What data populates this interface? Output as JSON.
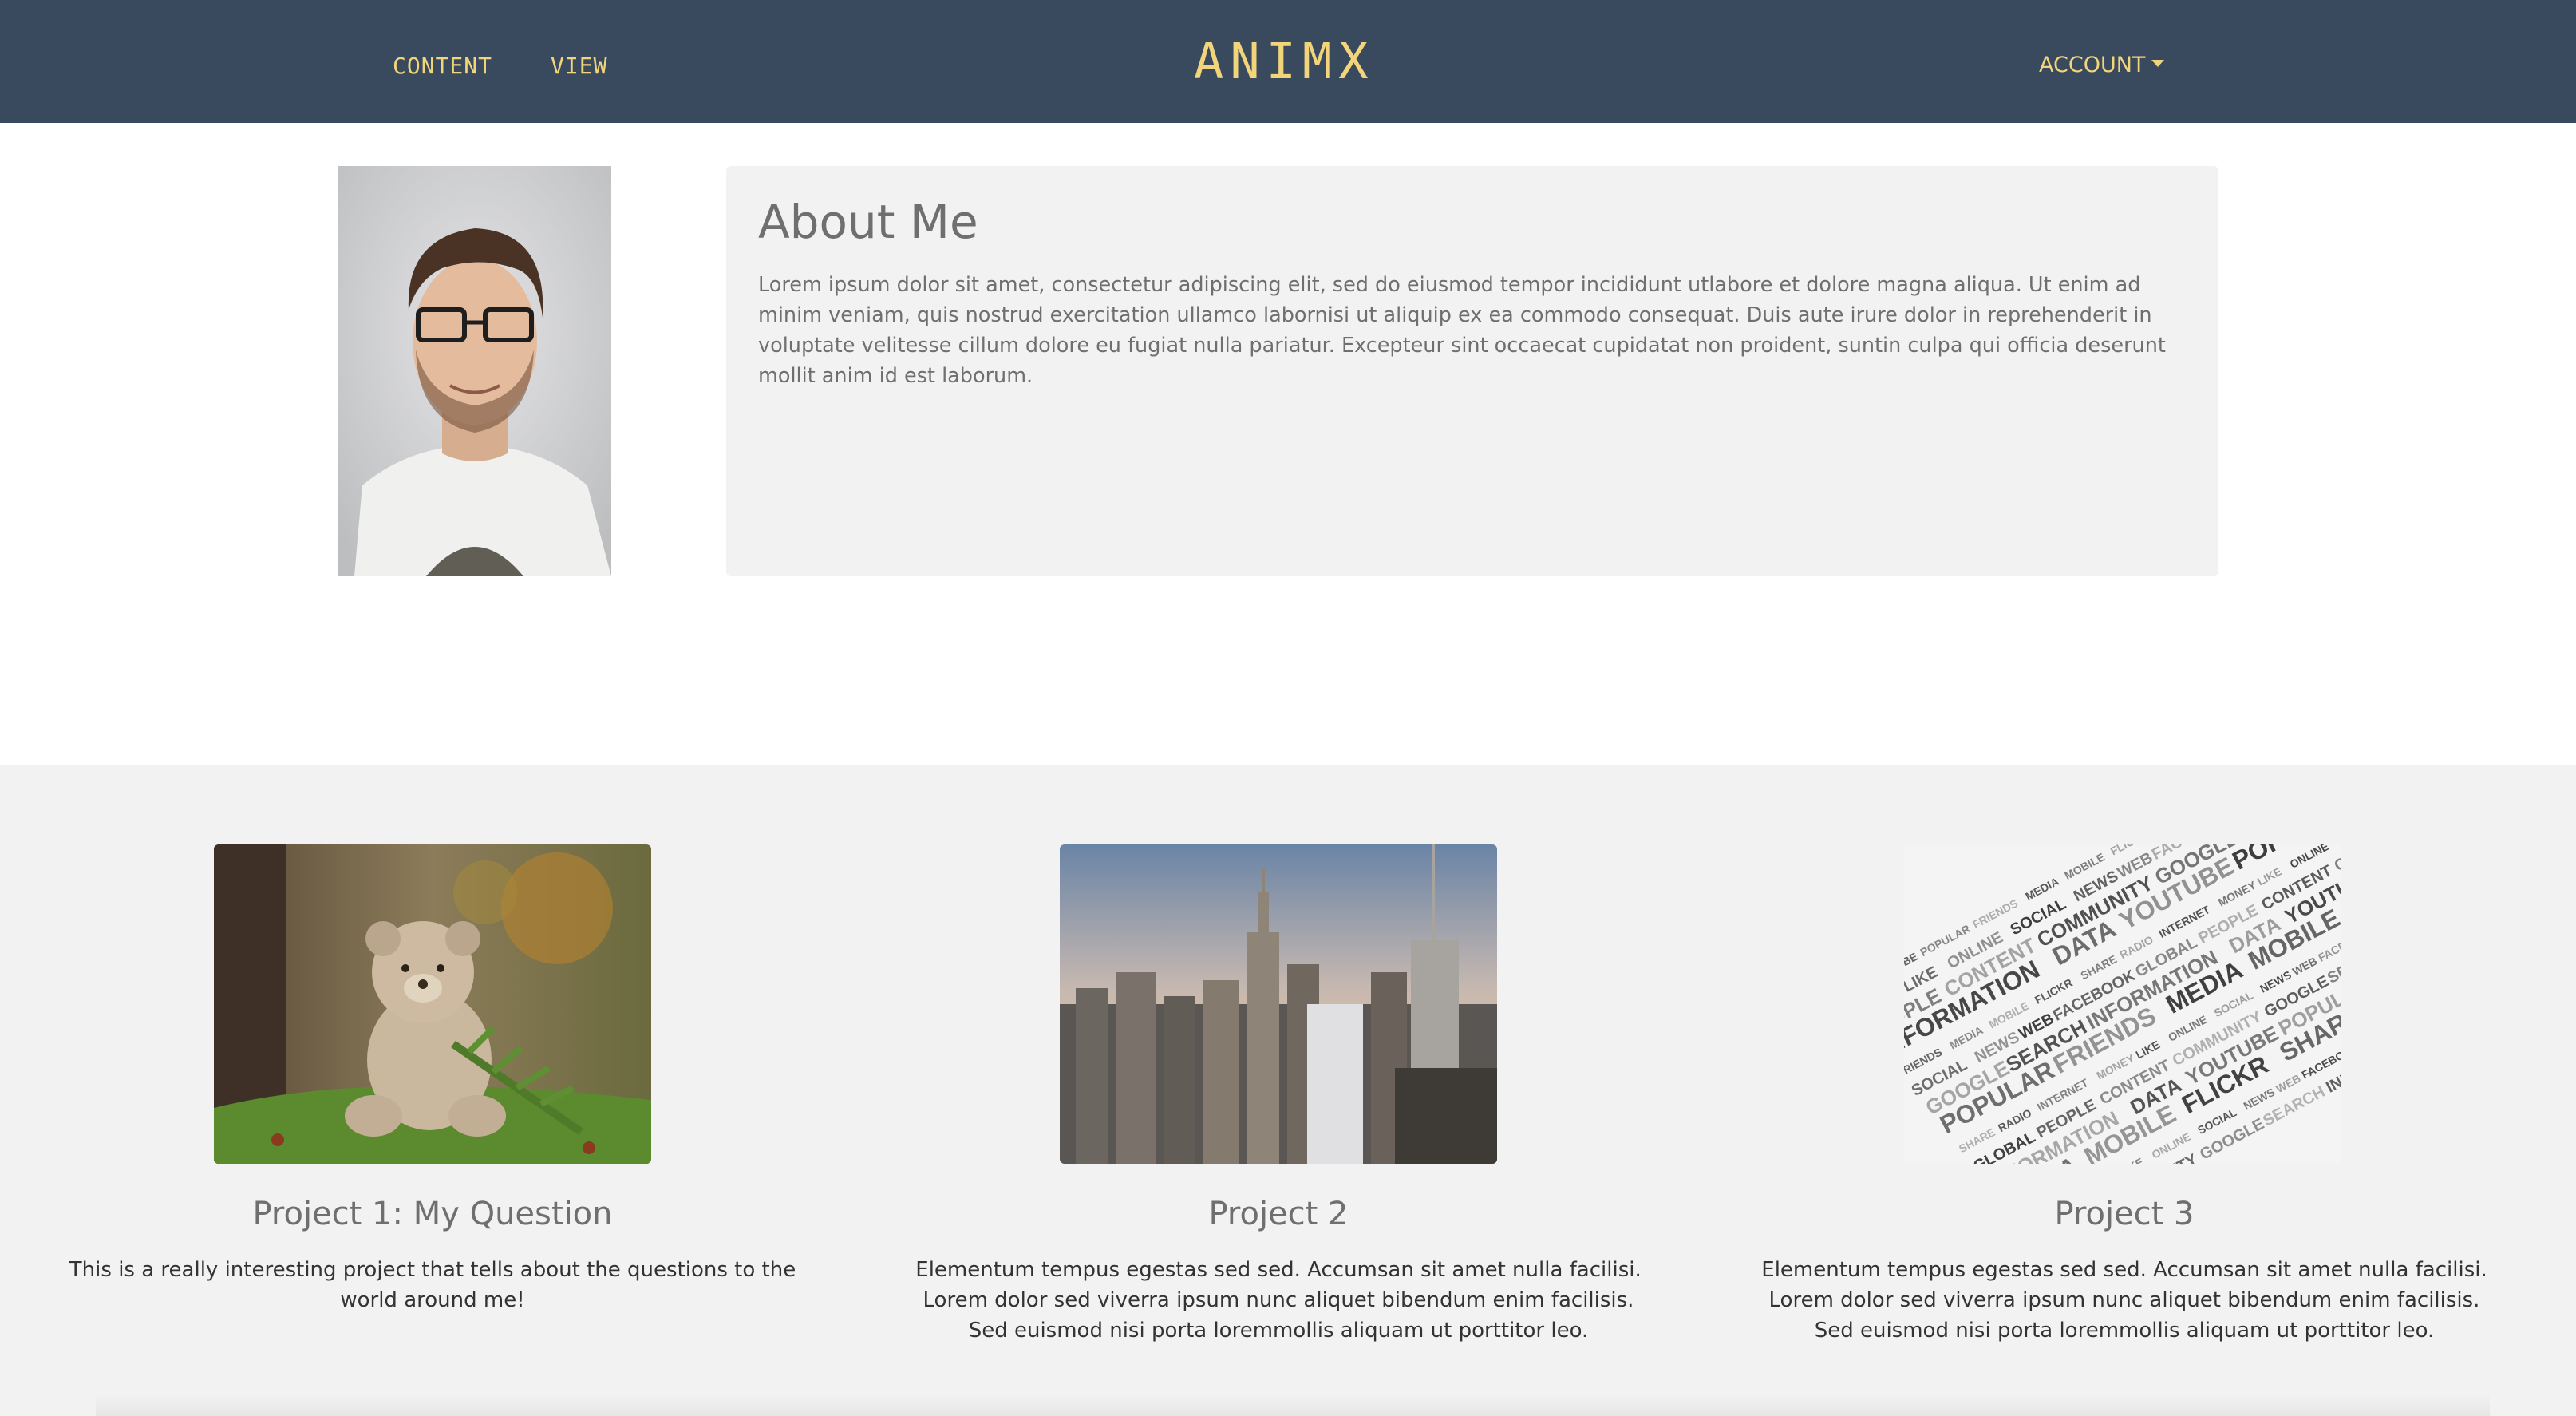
{
  "navbar": {
    "links": [
      "CONTENT",
      "VIEW"
    ],
    "brand": "ANIMX",
    "account_label": "ACCOUNT"
  },
  "about": {
    "title": "About Me",
    "text": "Lorem ipsum dolor sit amet, consectetur adipiscing elit, sed do eiusmod tempor incididunt utlabore et dolore magna aliqua. Ut enim ad minim veniam, quis nostrud exercitation ullamco labornisi ut aliquip ex ea commodo consequat. Duis aute irure dolor in reprehenderit in voluptate velitesse cillum dolore eu fugiat nulla pariatur. Excepteur sint occaecat cupidatat non proident, suntin culpa qui officia deserunt mollit anim id est laborum."
  },
  "projects": [
    {
      "title": "Project 1: My Question",
      "text": "This is a really interesting project that tells about the questions to the world around me!"
    },
    {
      "title": "Project 2",
      "text": "Elementum tempus egestas sed sed. Accumsan sit amet nulla facilisi. Lorem dolor sed viverra ipsum nunc aliquet bibendum enim facilisis. Sed euismod nisi porta loremmollis aliquam ut porttitor leo."
    },
    {
      "title": "Project 3",
      "text": "Elementum tempus egestas sed sed. Accumsan sit amet nulla facilisi. Lorem dolor sed viverra ipsum nunc aliquet bibendum enim facilisis. Sed euismod nisi porta loremmollis aliquam ut porttitor leo."
    }
  ],
  "wordcloud_words": [
    "DATA",
    "YOUTUBE",
    "POPULAR",
    "FRIENDS",
    "MEDIA",
    "MOBILE",
    "FLICKR",
    "SHARE",
    "RADIO",
    "INTERNET",
    "MONEY",
    "LIKE",
    "ONLINE",
    "SOCIAL",
    "NEWS",
    "WEB",
    "FACEBOOK",
    "GLOBAL",
    "PEOPLE",
    "CONTENT",
    "COMMUNITY",
    "GOOGLE",
    "SEARCH",
    "INFORMATION"
  ]
}
